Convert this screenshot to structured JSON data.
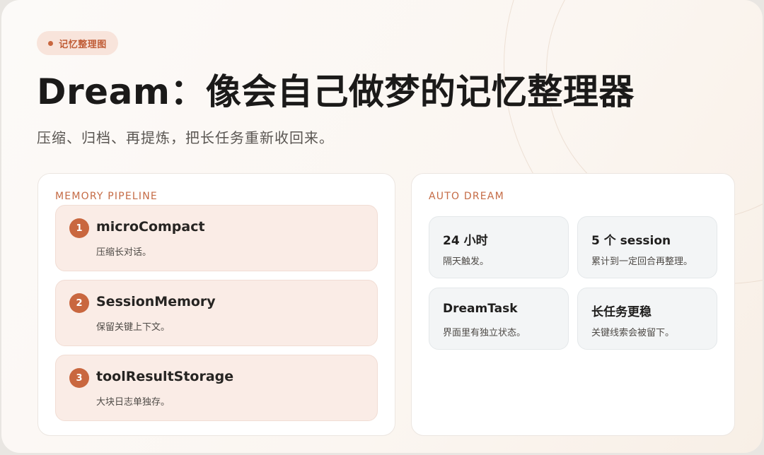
{
  "badge": {
    "label": "记忆整理图"
  },
  "title": "Dream：像会自己做梦的记忆整理器",
  "subtitle": "压缩、归档、再提炼，把长任务重新收回来。",
  "pipeline": {
    "label": "MEMORY PIPELINE",
    "steps": [
      {
        "num": "1",
        "title": "microCompact",
        "desc": "压缩长对话。"
      },
      {
        "num": "2",
        "title": "SessionMemory",
        "desc": "保留关键上下文。"
      },
      {
        "num": "3",
        "title": "toolResultStorage",
        "desc": "大块日志单独存。"
      }
    ]
  },
  "auto_dream": {
    "label": "AUTO DREAM",
    "cards": [
      {
        "title": "24 小时",
        "desc": "隔天触发。"
      },
      {
        "title": "5 个 session",
        "desc": "累计到一定回合再整理。"
      },
      {
        "title": "DreamTask",
        "desc": "界面里有独立状态。"
      },
      {
        "title": "长任务更稳",
        "desc": "关键线索会被留下。"
      }
    ]
  },
  "colors": {
    "accent": "#c9673f",
    "step_background": "#faece6",
    "card_background": "#f3f5f6"
  }
}
